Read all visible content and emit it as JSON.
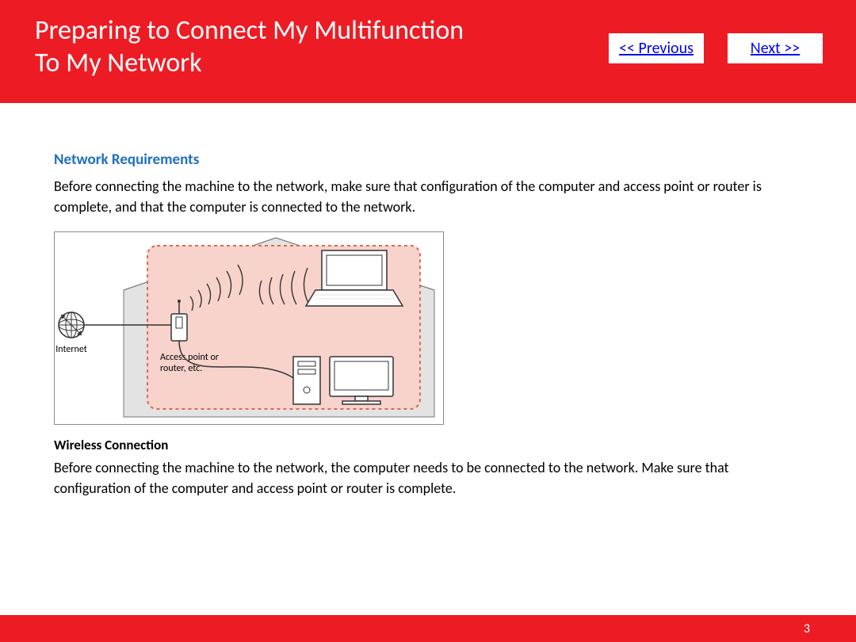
{
  "header": {
    "title_line1": "Preparing to Connect My Multifunction",
    "title_line2": "To My Network",
    "prev_label": "<< Previous",
    "next_label": "Next >>"
  },
  "section": {
    "heading": "Network Requirements",
    "intro": "Before connecting the machine to the network, make sure that configuration of the computer and access point or router is complete, and that the computer is connected to the network."
  },
  "diagram": {
    "internet_label": "Internet",
    "router_label_line1": "Access point or",
    "router_label_line2": "router, etc."
  },
  "wireless": {
    "heading": "Wireless Connection",
    "text": "Before connecting the machine to the network, the computer needs to be connected to the network. Make sure that configuration of the computer and access point or router is complete."
  },
  "footer": {
    "page_number": "3"
  }
}
